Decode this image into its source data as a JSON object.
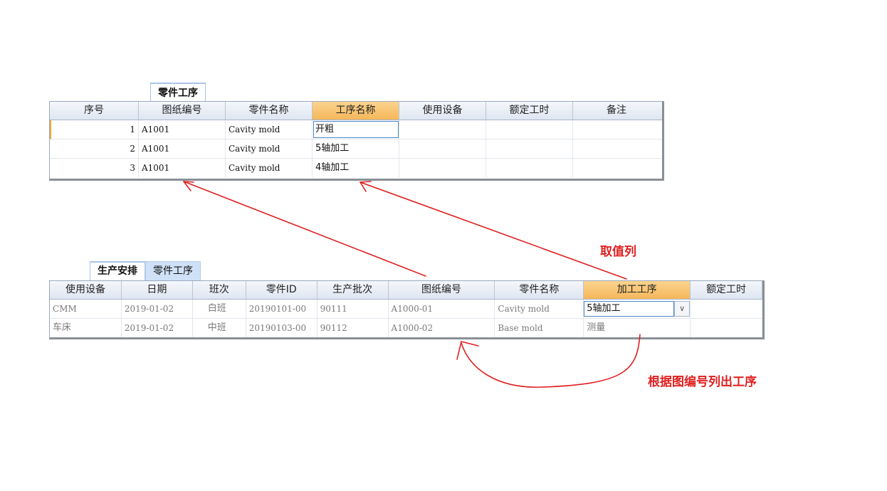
{
  "top_panel": {
    "tab_label": "零件工序",
    "columns": [
      "序号",
      "图纸编号",
      "零件名称",
      "工序名称",
      "使用设备",
      "额定工时",
      "备注"
    ],
    "rows": [
      {
        "no": "1",
        "drawing": "A1001",
        "part": "Cavity mold",
        "process": "开粗",
        "equipment": "",
        "hours": "",
        "note": ""
      },
      {
        "no": "2",
        "drawing": "A1001",
        "part": "Cavity mold",
        "process": "5轴加工",
        "equipment": "",
        "hours": "",
        "note": ""
      },
      {
        "no": "3",
        "drawing": "A1001",
        "part": "Cavity mold",
        "process": "4轴加工",
        "equipment": "",
        "hours": "",
        "note": ""
      }
    ]
  },
  "bottom_panel": {
    "tabs": [
      "生产安排",
      "零件工序"
    ],
    "columns": [
      "使用设备",
      "日期",
      "班次",
      "零件ID",
      "生产批次",
      "图纸编号",
      "零件名称",
      "加工工序",
      "额定工时"
    ],
    "rows": [
      {
        "equipment": "CMM",
        "date": "2019-01-02",
        "shift": "白班",
        "part_id": "20190101-00",
        "batch": "90111",
        "drawing": "A1000-01",
        "part": "Cavity mold",
        "process": "5轴加工",
        "hours": ""
      },
      {
        "equipment": "车床",
        "date": "2019-01-02",
        "shift": "中班",
        "part_id": "20190103-00",
        "batch": "90112",
        "drawing": "A1000-02",
        "part": "Base mold",
        "process": "测量",
        "hours": ""
      }
    ],
    "dropdown_glyph": "∨"
  },
  "annotations": {
    "value_column": "取值列",
    "list_by_drawing": "根据图编号列出工序"
  },
  "colors": {
    "arrow": "#e02020",
    "header_highlight": "#f5b75a",
    "grid_border": "#9aa8bd"
  }
}
